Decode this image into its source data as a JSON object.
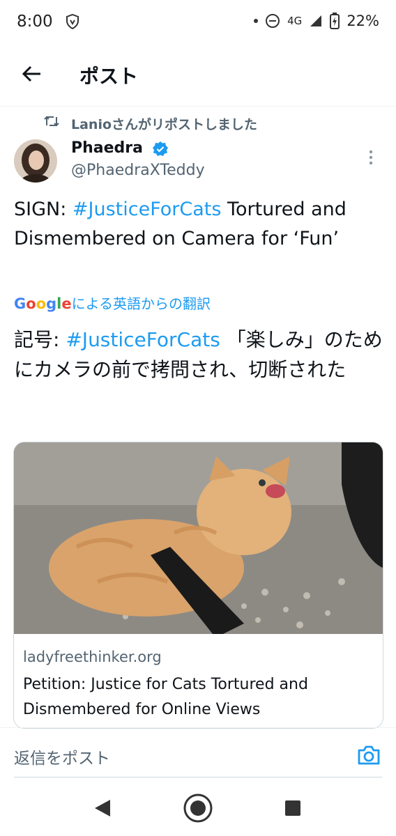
{
  "status_bar": {
    "time": "8:00",
    "network": "4G",
    "battery": "22%"
  },
  "header": {
    "title": "ポスト"
  },
  "repost": {
    "text": "Lanioさんがリポストしました"
  },
  "author": {
    "name": "Phaedra",
    "handle": "@PhaedraXTeddy"
  },
  "tweet": {
    "prefix": "SIGN: ",
    "hashtag": "#JusticeForCats",
    "suffix": " Tortured and Dismembered on Camera for ‘Fun’"
  },
  "translation": {
    "provider": "Google",
    "label": "による英語からの翻訳",
    "prefix": "記号: ",
    "hashtag": "#JusticeForCats",
    "suffix": " 「楽しみ」のためにカメラの前で拷問され、切断された"
  },
  "card": {
    "domain": "ladyfreethinker.org",
    "title": "Petition: Justice for Cats Tortured and Dismembered for Online Views"
  },
  "reply": {
    "placeholder": "返信をポスト"
  },
  "icons": {
    "back": "arrow-left-icon",
    "repost": "repost-icon",
    "verified": "verified-badge-icon",
    "more": "more-vertical-icon",
    "camera": "camera-icon"
  },
  "colors": {
    "accent": "#1d9bf0",
    "secondary_text": "#536471"
  }
}
